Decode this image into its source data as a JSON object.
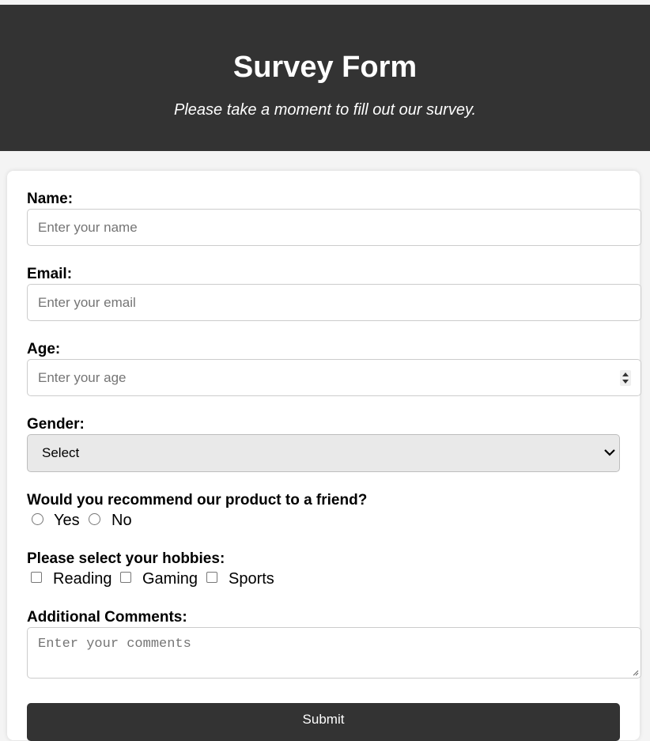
{
  "header": {
    "title": "Survey Form",
    "subtitle": "Please take a moment to fill out our survey."
  },
  "form": {
    "name": {
      "label": "Name:",
      "placeholder": "Enter your name"
    },
    "email": {
      "label": "Email:",
      "placeholder": "Enter your email"
    },
    "age": {
      "label": "Age:",
      "placeholder": "Enter your age"
    },
    "gender": {
      "label": "Gender:",
      "selected": "Select"
    },
    "recommend": {
      "question": "Would you recommend our product to a friend?",
      "options": [
        "Yes",
        "No"
      ]
    },
    "hobbies": {
      "question": "Please select your hobbies:",
      "options": [
        "Reading",
        "Gaming",
        "Sports"
      ]
    },
    "comments": {
      "label": "Additional Comments:",
      "placeholder": "Enter your comments"
    },
    "submit_label": "Submit"
  },
  "colors": {
    "header_bg": "#333333",
    "button_bg": "#333333",
    "page_bg": "#f4f4f4"
  }
}
